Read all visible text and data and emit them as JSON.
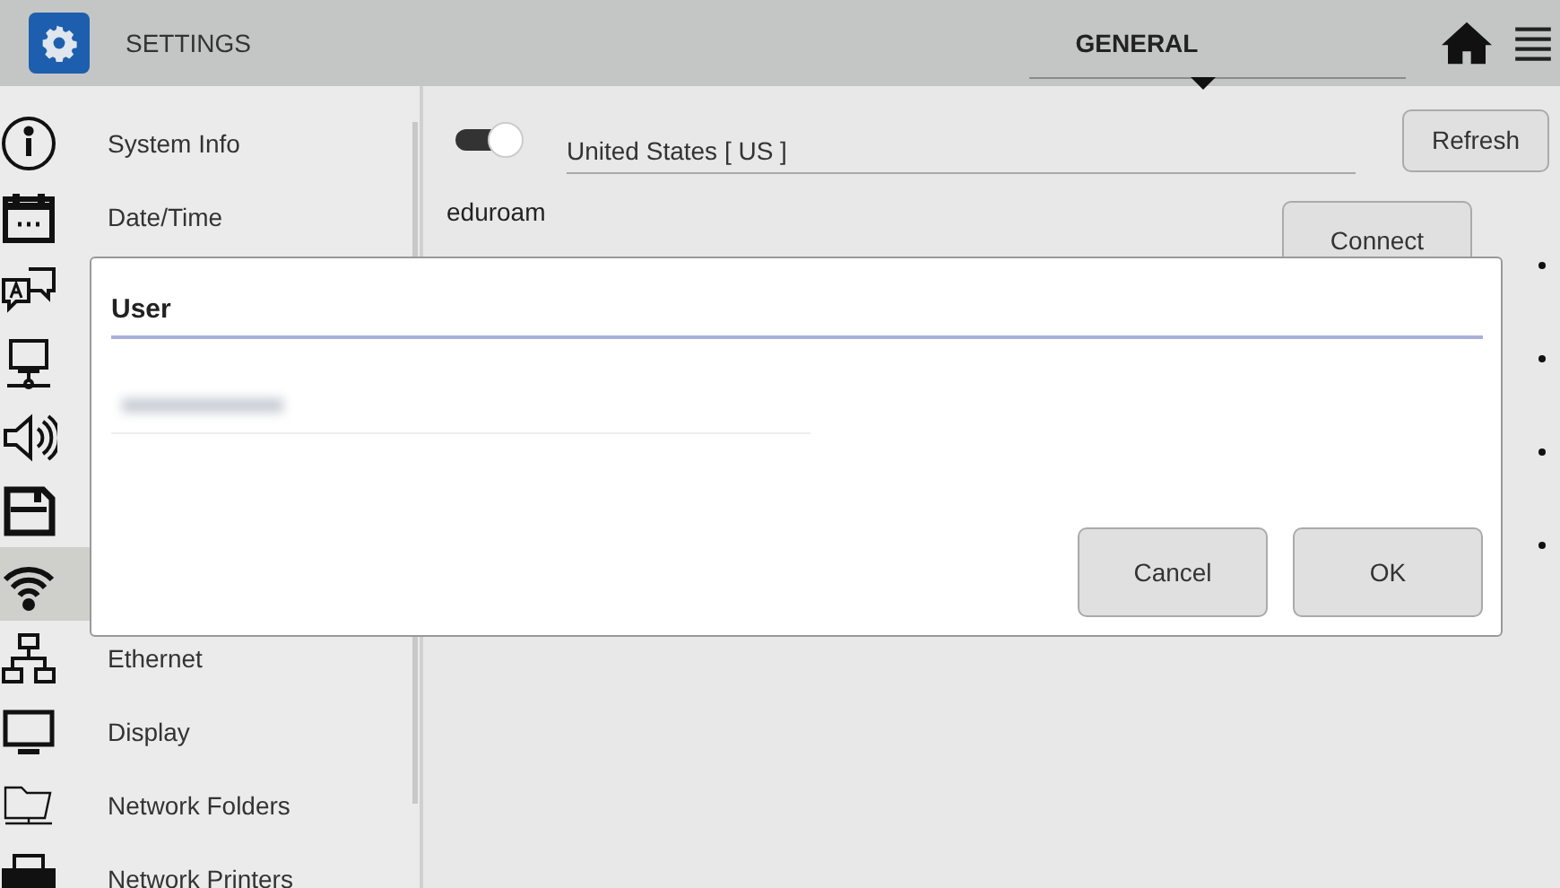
{
  "window": {
    "title": "SETTINGS"
  },
  "tab": {
    "label": "GENERAL"
  },
  "sidebar": {
    "items": [
      {
        "label": "System Info",
        "selected": false
      },
      {
        "label": "Date/Time",
        "selected": false
      },
      {
        "selected": false
      },
      {
        "selected": false
      },
      {
        "selected": false
      },
      {
        "selected": false
      },
      {
        "selected": true
      },
      {
        "label": "Ethernet",
        "selected": false
      },
      {
        "label": "Display",
        "selected": false
      },
      {
        "label": "Network Folders",
        "selected": false
      },
      {
        "label": "Network Printers",
        "selected": false
      }
    ]
  },
  "wifi": {
    "on": true,
    "country": "United States [ US ]",
    "refresh_button": "Refresh",
    "networks": [
      {
        "name": "eduroam",
        "action": "Connect"
      }
    ]
  },
  "dialog": {
    "title": "User",
    "buttons": [
      "Cancel",
      "OK"
    ]
  }
}
